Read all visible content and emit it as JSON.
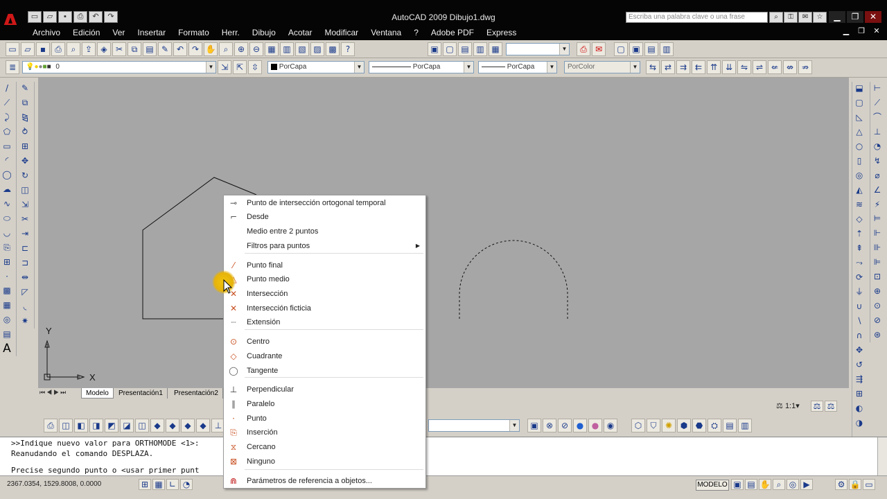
{
  "window": {
    "title": "AutoCAD 2009 Dibujo1.dwg",
    "logo": "A",
    "search_placeholder": "Escriba una palabra clave o una frase"
  },
  "menubar": [
    "Archivo",
    "Edición",
    "Ver",
    "Insertar",
    "Formato",
    "Herr.",
    "Dibujo",
    "Acotar",
    "Modificar",
    "Ventana",
    "?",
    "Adobe PDF",
    "Express"
  ],
  "layers": {
    "current_layer": "0",
    "color": "PorCapa",
    "linetype": "PorCapa",
    "lineweight": "PorCapa",
    "plotstyle": "PorColor"
  },
  "tabs": [
    "Modelo",
    "Presentación1",
    "Presentación2"
  ],
  "annotation_scale": "1:1",
  "command_window": {
    "line1": ">>Indique nuevo valor para ORTHOMODE <1>:",
    "line2": "Reanudando el comando DESPLAZA.",
    "line3": "Precise segundo punto o <usar primer punt"
  },
  "status": {
    "coords": "2367.0354, 1529.8008, 0.0000",
    "model_label": "MODELO"
  },
  "ucs": {
    "x_label": "X",
    "y_label": "Y"
  },
  "context_menu": {
    "items": [
      {
        "label": "Punto de intersección ortogonal temporal",
        "icon": "temp-track-icon"
      },
      {
        "label": "Desde",
        "icon": "from-icon"
      },
      {
        "label": "Medio entre 2 puntos",
        "icon": ""
      },
      {
        "label": "Filtros para puntos",
        "icon": "",
        "submenu": true
      },
      {
        "label": "Punto final",
        "icon": "endpoint-icon"
      },
      {
        "label": "Punto medio",
        "icon": "midpoint-icon"
      },
      {
        "label": "Intersección",
        "icon": "intersection-icon"
      },
      {
        "label": "Intersección ficticia",
        "icon": "apparent-intersection-icon"
      },
      {
        "label": "Extensión",
        "icon": "extension-icon"
      },
      {
        "label": "Centro",
        "icon": "center-icon"
      },
      {
        "label": "Cuadrante",
        "icon": "quadrant-icon"
      },
      {
        "label": "Tangente",
        "icon": "tangent-icon"
      },
      {
        "label": "Perpendicular",
        "icon": "perpendicular-icon"
      },
      {
        "label": "Paralelo",
        "icon": "parallel-icon"
      },
      {
        "label": "Punto",
        "icon": "node-icon"
      },
      {
        "label": "Inserción",
        "icon": "insertion-icon"
      },
      {
        "label": "Cercano",
        "icon": "nearest-icon"
      },
      {
        "label": "Ninguno",
        "icon": "none-icon"
      },
      {
        "label": "Parámetros de referencia a objetos...",
        "icon": "osnap-settings-icon"
      }
    ]
  },
  "colors": {
    "drawing_bg": "#a6a6a6",
    "highlight": "#f1c40f",
    "logo": "#d01818"
  }
}
